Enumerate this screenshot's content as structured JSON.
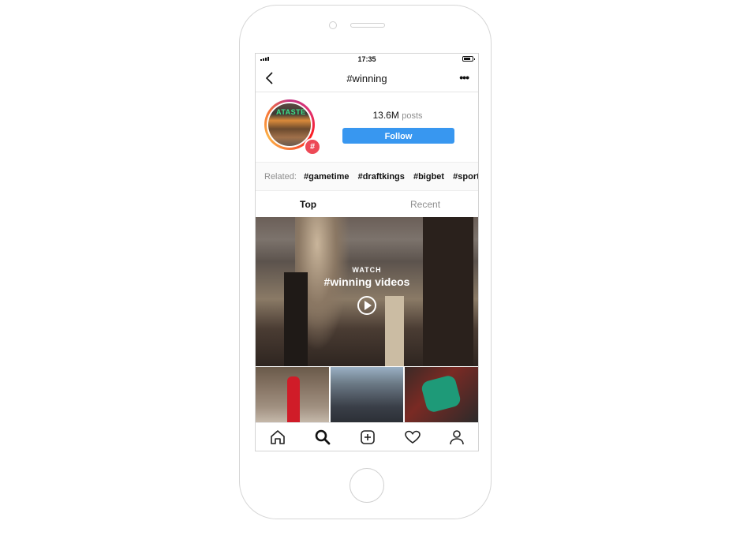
{
  "status_bar": {
    "time": "17:35"
  },
  "nav": {
    "title": "#winning",
    "more_label": "•••"
  },
  "header": {
    "avatar_sign_text": "ATASTE",
    "badge": "#",
    "post_count": "13.6M",
    "post_label": "posts",
    "follow_label": "Follow"
  },
  "related": {
    "label": "Related:",
    "tags": [
      "#gametime",
      "#draftkings",
      "#bigbet",
      "#sports"
    ]
  },
  "tabs": [
    {
      "label": "Top",
      "active": true
    },
    {
      "label": "Recent",
      "active": false
    }
  ],
  "video": {
    "watch_label": "WATCH",
    "title": "#winning videos"
  },
  "tab_bar": [
    "home-icon",
    "search-icon",
    "add-post-icon",
    "activity-heart-icon",
    "profile-icon"
  ],
  "colors": {
    "accent": "#3897f0",
    "badge": "#ed4956",
    "muted_text": "#8e8e8e"
  }
}
